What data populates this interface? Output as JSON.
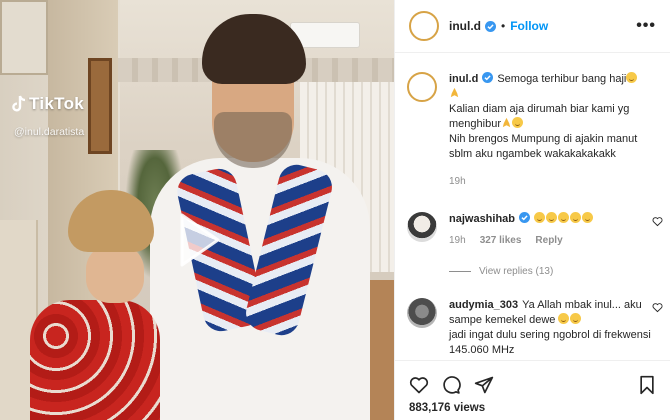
{
  "video": {
    "watermark_brand": "TikTok",
    "watermark_handle": "@inul.daratista"
  },
  "post": {
    "username": "inul.d",
    "follow_label": "Follow",
    "more_label": "•••"
  },
  "caption": {
    "username": "inul.d",
    "line1": "Semoga terhibur bang haji",
    "line2": "Kalian diam aja dirumah biar kami yg menghibur",
    "line3": "Nih brengos Mumpung di ajakin manut sblm aku ngambek wakakakakakk",
    "time": "19h"
  },
  "comments": [
    {
      "username": "najwashihab",
      "verified": true,
      "time": "19h",
      "likes": "327 likes",
      "reply_label": "Reply",
      "view_replies": "View replies (13)"
    },
    {
      "username": "audymia_303",
      "text": "Ya Allah mbak inul... aku sampe kemekel dewe",
      "text2": "jadi ingat dulu sering ngobrol di frekwensi 145.060 MHz"
    }
  ],
  "stats": {
    "views": "883,176 views"
  },
  "icons": [
    "verified-icon",
    "heart-icon",
    "comment-icon",
    "share-icon",
    "bookmark-icon",
    "play-icon",
    "more-icon"
  ],
  "colors": {
    "link_blue": "#0095f6",
    "verified_blue": "#3897f0",
    "muted": "#8e8e8e",
    "text": "#262626"
  }
}
